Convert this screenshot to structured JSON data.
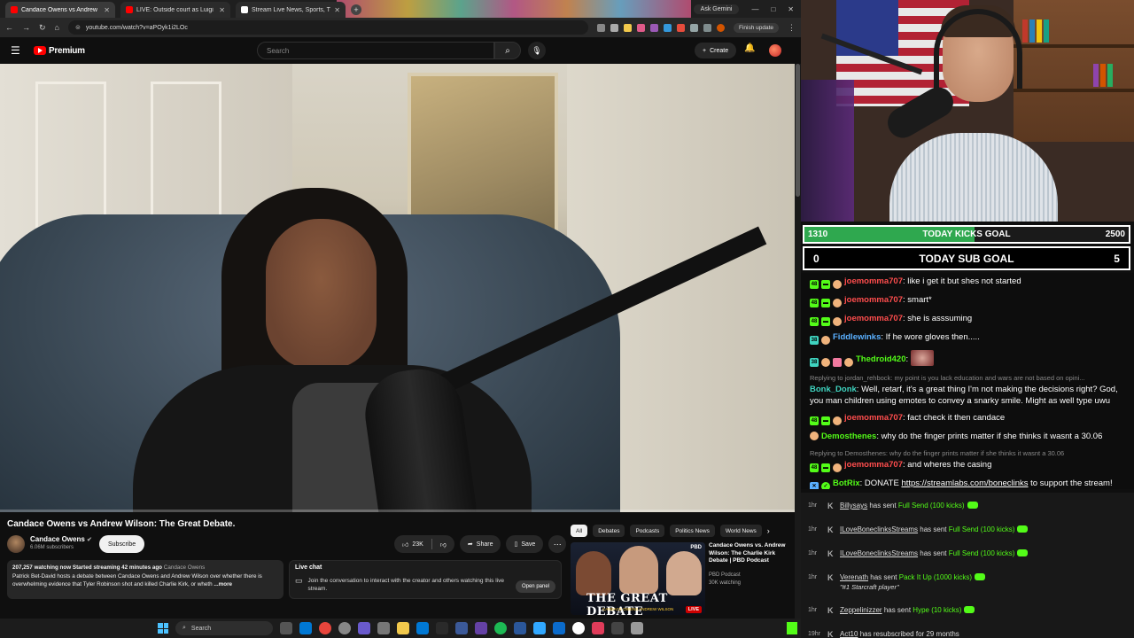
{
  "browser": {
    "tabs": [
      {
        "label": "Candace Owens vs Andrew",
        "favicon_color": "#ff0000",
        "active": true
      },
      {
        "label": "LIVE: Outside court as Luigi M",
        "favicon_color": "#ff0000",
        "active": false
      },
      {
        "label": "Stream Live News, Sports, T",
        "favicon_color": "#ffffff",
        "active": false
      }
    ],
    "new_tab": "+",
    "ask_gemini": "Ask Gemini",
    "url": "youtube.com/watch?v=aPOyk1i2LOc",
    "finish_update": "Finish update"
  },
  "youtube": {
    "logo_text": "Premium",
    "search_placeholder": "Search",
    "create_label": "Create",
    "video": {
      "progress": 0.0
    },
    "title": "Candace Owens vs Andrew Wilson: The Great Debate.",
    "channel": {
      "name": "Candace Owens",
      "subscribers": "6.06M subscribers"
    },
    "subscribe_label": "Subscribe",
    "likes": "23K",
    "share_label": "Share",
    "save_label": "Save",
    "description": {
      "stats": "207,257 watching now  Started streaming 42 minutes ago",
      "channel": "Candace Owens",
      "text": "Patrick Bet-David hosts a debate between Candace Owens and Andrew Wilson over whether there is overwhelming evidence that Tyler Robinson shot and killed Charlie Kirk, or wheth",
      "more": "...more"
    },
    "live_chat": {
      "title": "Live chat",
      "body": "Join the conversation to interact with the creator and others watching this live stream.",
      "button": "Open panel"
    },
    "chips": [
      "All",
      "Debates",
      "Podcasts",
      "Politics News",
      "World News"
    ],
    "recommendation": {
      "title": "Candace Owens vs. Andrew Wilson: The Charlie Kirk Debate | PBD Podcast",
      "channel": "PBD Podcast",
      "watching": "30K watching",
      "thumb_big": "THE GREAT DEBATE",
      "thumb_names": "CANDACE OWENS   ANDREW WILSON",
      "thumb_logo": "PBD",
      "live": "LIVE"
    }
  },
  "goals": {
    "kicks": {
      "current": "1310",
      "label": "TODAY KICKS GOAL",
      "target": "2500",
      "fraction": 0.524
    },
    "subs": {
      "current": "0",
      "label": "TODAY SUB GOAL",
      "target": "5"
    }
  },
  "chat": [
    {
      "user": "joemomma707",
      "color": "#ff4d4d",
      "badges": [
        "48",
        "sub",
        "face"
      ],
      "text": ": like i get it but shes not started"
    },
    {
      "user": "joemomma707",
      "color": "#ff4d4d",
      "badges": [
        "48",
        "sub",
        "face"
      ],
      "text": ": smart*"
    },
    {
      "user": "joemomma707",
      "color": "#ff4d4d",
      "badges": [
        "48",
        "sub",
        "face"
      ],
      "text": ": she is asssuming"
    },
    {
      "user": "Fiddlewinks",
      "color": "#5ab0ff",
      "badges": [
        "38",
        "face"
      ],
      "text": ": If he wore gloves then....."
    },
    {
      "user": "Thedroid420",
      "color": "#53fc18",
      "badges": [
        "38",
        "face2",
        "pink",
        "face"
      ],
      "text": ": ",
      "emote": true
    },
    {
      "reply": "Replying to jordan_rehbock: my point is you lack education and wars are not based on opini...",
      "user": "Bonk_Donk",
      "color": "#3fd4c0",
      "badges": [],
      "text": ": Well, retarf, it's a great thing I'm not making the decisions right? God, you man children using emotes to convey a snarky smile. Might as well type uwu"
    },
    {
      "user": "joemomma707",
      "color": "#ff4d4d",
      "badges": [
        "48",
        "sub",
        "face"
      ],
      "text": ": fact check it then candace"
    },
    {
      "user": "Demosthenes",
      "color": "#53fc18",
      "badges": [
        "face"
      ],
      "text": ": why do the finger prints matter if she thinks it wasnt a 30.06"
    },
    {
      "reply": "Replying to Demosthenes: why do the finger prints matter if she thinks it wasnt a 30.06",
      "user": "joemomma707",
      "color": "#ff4d4d",
      "badges": [
        "48",
        "sub",
        "face"
      ],
      "text": ": and wheres the casing"
    },
    {
      "user": "BotRix",
      "color": "#53fc18",
      "badges": [
        "bot",
        "check"
      ],
      "text": ": DONATE ",
      "link": "https://streamlabs.com/boneclinks",
      "after": " to support the stream!"
    }
  ],
  "events": [
    {
      "time": "1hr",
      "name": "Billysays",
      "action": "has sent",
      "gift": "Full Send (100 kicks)"
    },
    {
      "time": "1hr",
      "name": "ILoveBoneclinksStreams",
      "action": "has sent",
      "gift": "Full Send (100 kicks)"
    },
    {
      "time": "1hr",
      "name": "ILoveBoneclinksStreams",
      "action": "has sent",
      "gift": "Full Send (100 kicks)"
    },
    {
      "time": "1hr",
      "name": "Verenath",
      "action": "has sent",
      "gift": "Pack It Up (1000 kicks)",
      "note": "\"#1 Starcraft player\""
    },
    {
      "time": "1hr",
      "name": "Zeppelinizzer",
      "action": "has sent",
      "gift": "Hype (10 kicks)"
    },
    {
      "time": "19hr",
      "name": "Act10",
      "action": "has resubscribed for 29 months",
      "gift": ""
    }
  ],
  "taskbar": {
    "search_placeholder": "Search"
  },
  "colors": {
    "kick_green": "#53fc18",
    "youtube_red": "#ff0000"
  }
}
